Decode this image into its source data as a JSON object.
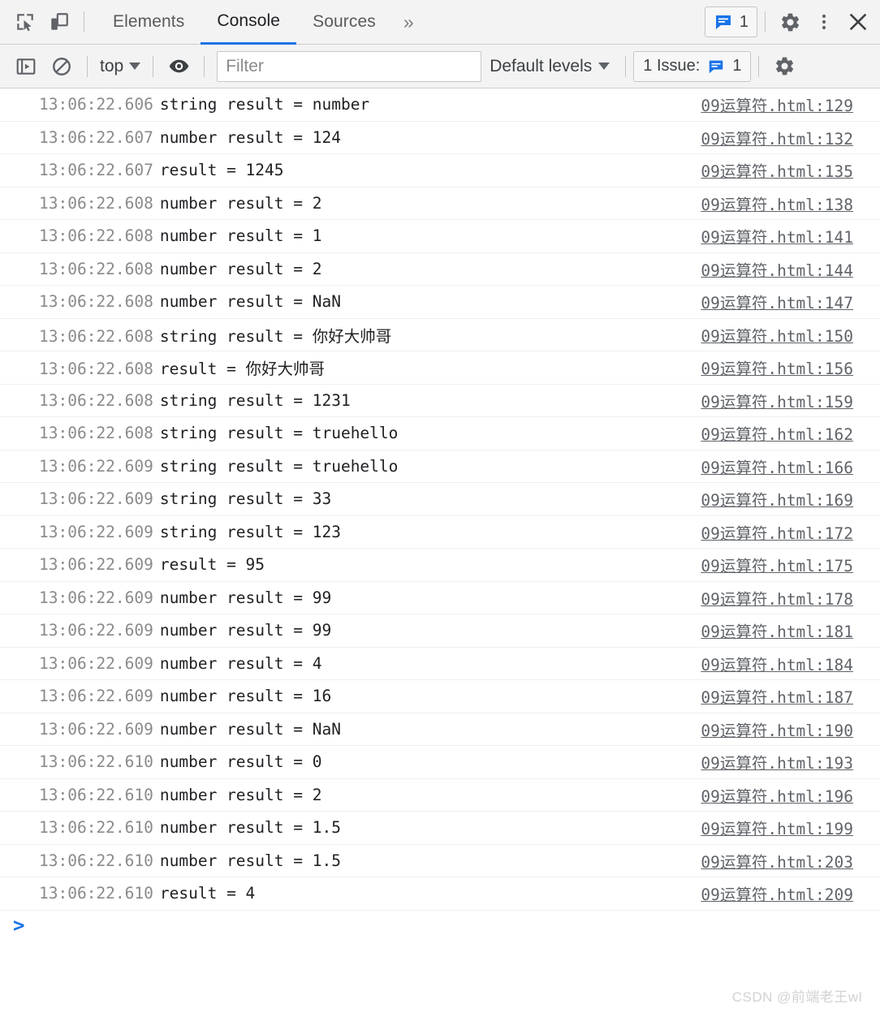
{
  "tabbar": {
    "inspect_icon": "inspect-element-icon",
    "device_icon": "device-toolbar-icon",
    "tabs": [
      {
        "label": "Elements",
        "active": false
      },
      {
        "label": "Console",
        "active": true
      },
      {
        "label": "Sources",
        "active": false
      }
    ],
    "more_tabs_label": "»",
    "issues_badge_count": "1",
    "settings_icon": "gear-icon",
    "kebab_icon": "more-options-icon",
    "close_icon": "close-icon"
  },
  "filterbar": {
    "sidebar_toggle_icon": "console-sidebar-icon",
    "clear_icon": "clear-console-icon",
    "context_label": "top",
    "live_expression_icon": "eye-icon",
    "filter_placeholder": "Filter",
    "filter_value": "",
    "levels_label": "Default levels",
    "issue_button_label": "1 Issue:",
    "issue_button_count": "1",
    "settings_icon": "gear-icon"
  },
  "colors": {
    "accent": "#1a73e8",
    "toolbar_bg": "#f3f3f3",
    "row_border": "#f0f0f0",
    "timestamp": "#8a8a8a",
    "message": "#202124",
    "source_link": "#5f6368",
    "watermark": "#d2d2d2"
  },
  "console": {
    "source_file": "09运算符.html",
    "prompt_symbol": ">",
    "rows": [
      {
        "time": "13:06:22.606",
        "message": "string result = number",
        "source": "09运算符.html:129"
      },
      {
        "time": "13:06:22.607",
        "message": "number result = 124",
        "source": "09运算符.html:132"
      },
      {
        "time": "13:06:22.607",
        "message": "result = 1245",
        "source": "09运算符.html:135"
      },
      {
        "time": "13:06:22.608",
        "message": "number result = 2",
        "source": "09运算符.html:138"
      },
      {
        "time": "13:06:22.608",
        "message": "number result = 1",
        "source": "09运算符.html:141"
      },
      {
        "time": "13:06:22.608",
        "message": "number result = 2",
        "source": "09运算符.html:144"
      },
      {
        "time": "13:06:22.608",
        "message": "number result = NaN",
        "source": "09运算符.html:147"
      },
      {
        "time": "13:06:22.608",
        "message": "string result = 你好大帅哥",
        "source": "09运算符.html:150"
      },
      {
        "time": "13:06:22.608",
        "message": "result = 你好大帅哥",
        "source": "09运算符.html:156"
      },
      {
        "time": "13:06:22.608",
        "message": "string result = 1231",
        "source": "09运算符.html:159"
      },
      {
        "time": "13:06:22.608",
        "message": "string result = truehello",
        "source": "09运算符.html:162"
      },
      {
        "time": "13:06:22.609",
        "message": "string result = truehello",
        "source": "09运算符.html:166"
      },
      {
        "time": "13:06:22.609",
        "message": "string result = 33",
        "source": "09运算符.html:169"
      },
      {
        "time": "13:06:22.609",
        "message": "string result = 123",
        "source": "09运算符.html:172"
      },
      {
        "time": "13:06:22.609",
        "message": "result = 95",
        "source": "09运算符.html:175"
      },
      {
        "time": "13:06:22.609",
        "message": "number result = 99",
        "source": "09运算符.html:178"
      },
      {
        "time": "13:06:22.609",
        "message": "number result = 99",
        "source": "09运算符.html:181"
      },
      {
        "time": "13:06:22.609",
        "message": "number result = 4",
        "source": "09运算符.html:184"
      },
      {
        "time": "13:06:22.609",
        "message": "number result = 16",
        "source": "09运算符.html:187"
      },
      {
        "time": "13:06:22.609",
        "message": "number result = NaN",
        "source": "09运算符.html:190"
      },
      {
        "time": "13:06:22.610",
        "message": "number result = 0",
        "source": "09运算符.html:193"
      },
      {
        "time": "13:06:22.610",
        "message": "number result = 2",
        "source": "09运算符.html:196"
      },
      {
        "time": "13:06:22.610",
        "message": "number result = 1.5",
        "source": "09运算符.html:199"
      },
      {
        "time": "13:06:22.610",
        "message": "number result = 1.5",
        "source": "09运算符.html:203"
      },
      {
        "time": "13:06:22.610",
        "message": "result = 4",
        "source": "09运算符.html:209"
      }
    ]
  },
  "watermark": "CSDN @前端老王wl"
}
